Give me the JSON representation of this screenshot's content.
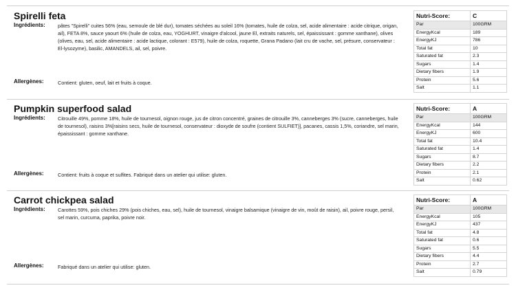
{
  "products": [
    {
      "name": "Spirelli feta",
      "ingredients_label": "Ingrédients:",
      "ingredients": "pâtes \"Spirelli\" cuites 56% (eau, semoule de blé dur), tomates séchées au soleil 16% (tomates, huile de colza, sel, acide alimentaire : acide citrique, origan, ail), FETA 8%, sauce yaourt 6% (huile de colza, eau, YOGHURT, vinaigre d'alcool, jaune El, extraits naturels, sel, épaississant : gomme xanthane), olives (olives, eau, sel, acide alimentaire : acide lactique, colorant : E579), huile de colza, roquette, Grana Padano (lait cru de vache, sel, présure, conservateur : El-lysozyme), basilic, AMANDELS, ail, sel, poivre.",
      "allergens_label": "Allergènes:",
      "allergens": "Contient: gluten, oeuf, lait et fruits à coque.",
      "nutri_label": "Nutri-Score:",
      "nutri_score": "C",
      "nutrition": [
        {
          "k": "Par",
          "v": "100GRM"
        },
        {
          "k": "EnergyKcal",
          "v": "189"
        },
        {
          "k": "EnergyKJ",
          "v": "786"
        },
        {
          "k": "Total fat",
          "v": "10"
        },
        {
          "k": "Saturated fat",
          "v": "2.3"
        },
        {
          "k": "Sugars",
          "v": "1.4"
        },
        {
          "k": "Dietary fibers",
          "v": "1.9"
        },
        {
          "k": "Protein",
          "v": "5.6"
        },
        {
          "k": "Salt",
          "v": "1.1"
        }
      ]
    },
    {
      "name": "Pumpkin superfood salad",
      "ingredients_label": "Ingrédients:",
      "ingredients": "Citrouille 49%, pomme 18%, huile de tournesol, oignon rouge, jus de citron concentré, graines de citrouille 3%, canneberges 3% (sucre, canneberges, huile de tournesol), raisins 3%[raisins secs, huile de tournesol, conservateur : dioxyde de soufre (contient SULFIET)], pacanes, cassis 1,5%, coriandre, sel marin, épaississant : gomme xanthane.",
      "allergens_label": "Allergènes:",
      "allergens": "Contient: fruits à coque et sulfites.  Fabriqué dans un atelier qui utilise: gluten.",
      "nutri_label": "Nutri-Score:",
      "nutri_score": "A",
      "nutrition": [
        {
          "k": "Par",
          "v": "100GRM"
        },
        {
          "k": "EnergyKcal",
          "v": "144"
        },
        {
          "k": "EnergyKJ",
          "v": "600"
        },
        {
          "k": "Total fat",
          "v": "10.4"
        },
        {
          "k": "Saturated fat",
          "v": "1.4"
        },
        {
          "k": "Sugars",
          "v": "8.7"
        },
        {
          "k": "Dietary fibers",
          "v": "2.2"
        },
        {
          "k": "Protein",
          "v": "2.1"
        },
        {
          "k": "Salt",
          "v": "0.62"
        }
      ]
    },
    {
      "name": "Carrot chickpea salad",
      "ingredients_label": "Ingrédients:",
      "ingredients": "Carottes 59%, pois chiches 29% (pois chiches, eau, sel), huile de tournesol, vinaigre balsamique (vinaigre de vin, moût de raisin), ail, poivre rouge, persil, sel marin, curcuma, paprika, poivre noir.",
      "allergens_label": "Allergènes:",
      "allergens": "Fabriqué dans un atelier qui utilise: gluten.",
      "nutri_label": "Nutri-Score:",
      "nutri_score": "A",
      "nutrition": [
        {
          "k": "Par",
          "v": "100GRM"
        },
        {
          "k": "EnergyKcal",
          "v": "105"
        },
        {
          "k": "EnergyKJ",
          "v": "437"
        },
        {
          "k": "Total fat",
          "v": "4.8"
        },
        {
          "k": "Saturated fat",
          "v": "0.6"
        },
        {
          "k": "Sugars",
          "v": "5.5"
        },
        {
          "k": "Dietary fibers",
          "v": "4.4"
        },
        {
          "k": "Protein",
          "v": "2.7"
        },
        {
          "k": "Salt",
          "v": "0.79"
        }
      ]
    }
  ]
}
